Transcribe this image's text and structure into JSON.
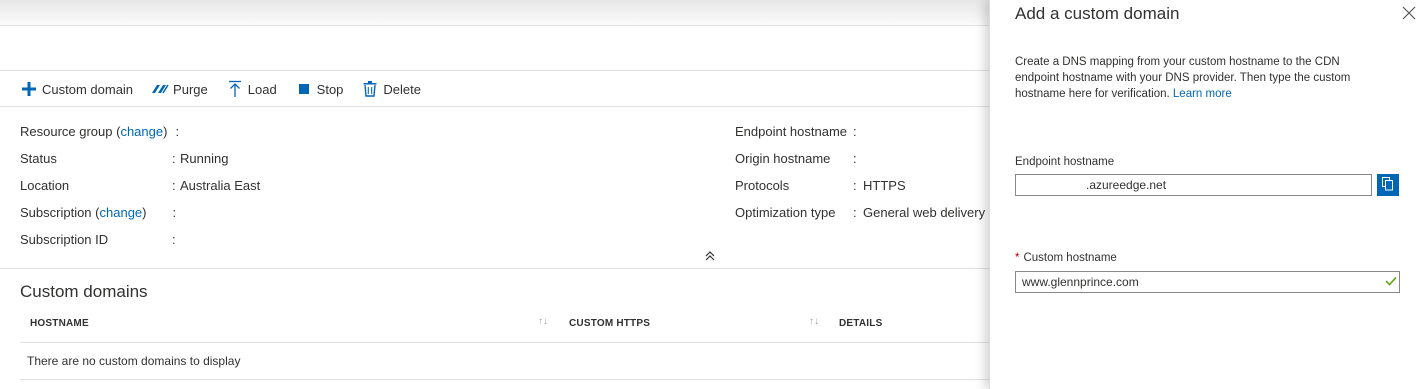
{
  "toolbar": {
    "custom_domain": "Custom domain",
    "purge": "Purge",
    "load": "Load",
    "stop": "Stop",
    "delete": "Delete"
  },
  "essentials": {
    "left": [
      {
        "key": "Resource group",
        "change": "change",
        "value": ""
      },
      {
        "key": "Status",
        "value": "Running"
      },
      {
        "key": "Location",
        "value": "Australia East"
      },
      {
        "key": "Subscription",
        "change": "change",
        "value": ""
      },
      {
        "key": "Subscription ID",
        "value": ""
      }
    ],
    "right": [
      {
        "key": "Endpoint hostname",
        "value": ""
      },
      {
        "key": "Origin hostname",
        "value": ""
      },
      {
        "key": "Protocols",
        "value": "HTTPS"
      },
      {
        "key": "Optimization type",
        "value": "General web delivery"
      }
    ]
  },
  "custom_domains": {
    "title": "Custom domains",
    "columns": [
      "HOSTNAME",
      "CUSTOM HTTPS",
      "DETAILS"
    ],
    "empty_message": "There are no custom domains to display"
  },
  "panel": {
    "title": "Add a custom domain",
    "description": "Create a DNS mapping from your custom hostname to the CDN endpoint hostname with your DNS provider. Then type the custom hostname here for verification.",
    "learn_more": "Learn more",
    "endpoint_label": "Endpoint hostname",
    "endpoint_value": ".azureedge.net",
    "custom_label": "Custom hostname",
    "custom_value": "www.glennprince.com"
  },
  "colors": {
    "accent": "#0067b8",
    "valid": "#57a300",
    "required": "#a80000"
  },
  "icons": [
    "plus-icon",
    "purge-icon",
    "load-icon",
    "stop-icon",
    "delete-icon",
    "collapse-icon",
    "close-icon",
    "copy-icon",
    "check-icon",
    "sort-icon"
  ]
}
